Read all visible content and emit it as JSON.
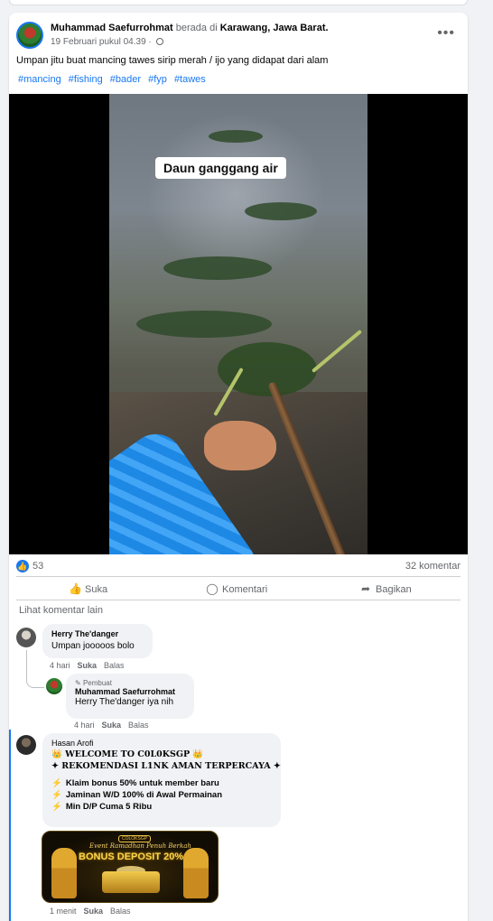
{
  "post": {
    "author": "Muhammad Saefurrohmat",
    "location_prefix": "berada di",
    "location": "Karawang, Jawa Barat.",
    "timestamp": "19 Februari pukul 04.39 ·",
    "more_icon": "more-options-icon",
    "caption": "Umpan jitu buat mancing tawes sirip merah / ijo yang didapat dari alam",
    "hashtags": [
      "#mancing",
      "#fishing",
      "#bader",
      "#fyp",
      "#tawes"
    ],
    "video_overlay_text": "Daun ganggang air"
  },
  "stats": {
    "like_count": "53",
    "comment_count": "32 komentar"
  },
  "actions": {
    "like": "Suka",
    "comment": "Komentari",
    "share": "Bagikan"
  },
  "comments": {
    "see_more": "Lihat komentar lain",
    "c1": {
      "name": "Herry The'danger",
      "text": "Umpan jooooos bolo",
      "time": "4 hari",
      "like": "Suka",
      "reply": "Balas"
    },
    "c2": {
      "tag": "Pembuat",
      "name": "Muhammad Saefurrohmat",
      "text": "Herry The'danger iya nih",
      "time": "4 hari",
      "like": "Suka",
      "reply": "Balas"
    },
    "c3": {
      "name": "Hasan Arofi",
      "title": "👑 WELCOME TO C0L0KSGP 👑",
      "subtitle": "✦ REKOMENDASI L1NK AMAN TERPERCAYA ✦",
      "bullets": [
        "Klaim bonus 50% untuk member baru",
        "Jaminan W/D 100% di Awal Permainan",
        "Min D/P Cuma 5 Ribu"
      ],
      "time": "1 menit",
      "like": "Suka",
      "reply": "Balas",
      "promo": {
        "logo": "COLOKSGP",
        "script": "Event Ramadhan Penuh Berkah",
        "main": "BONUS DEPOSIT 20%"
      }
    }
  },
  "colors": {
    "accent": "#1877f2",
    "muted": "#65676b",
    "bubble": "#f0f2f5"
  }
}
